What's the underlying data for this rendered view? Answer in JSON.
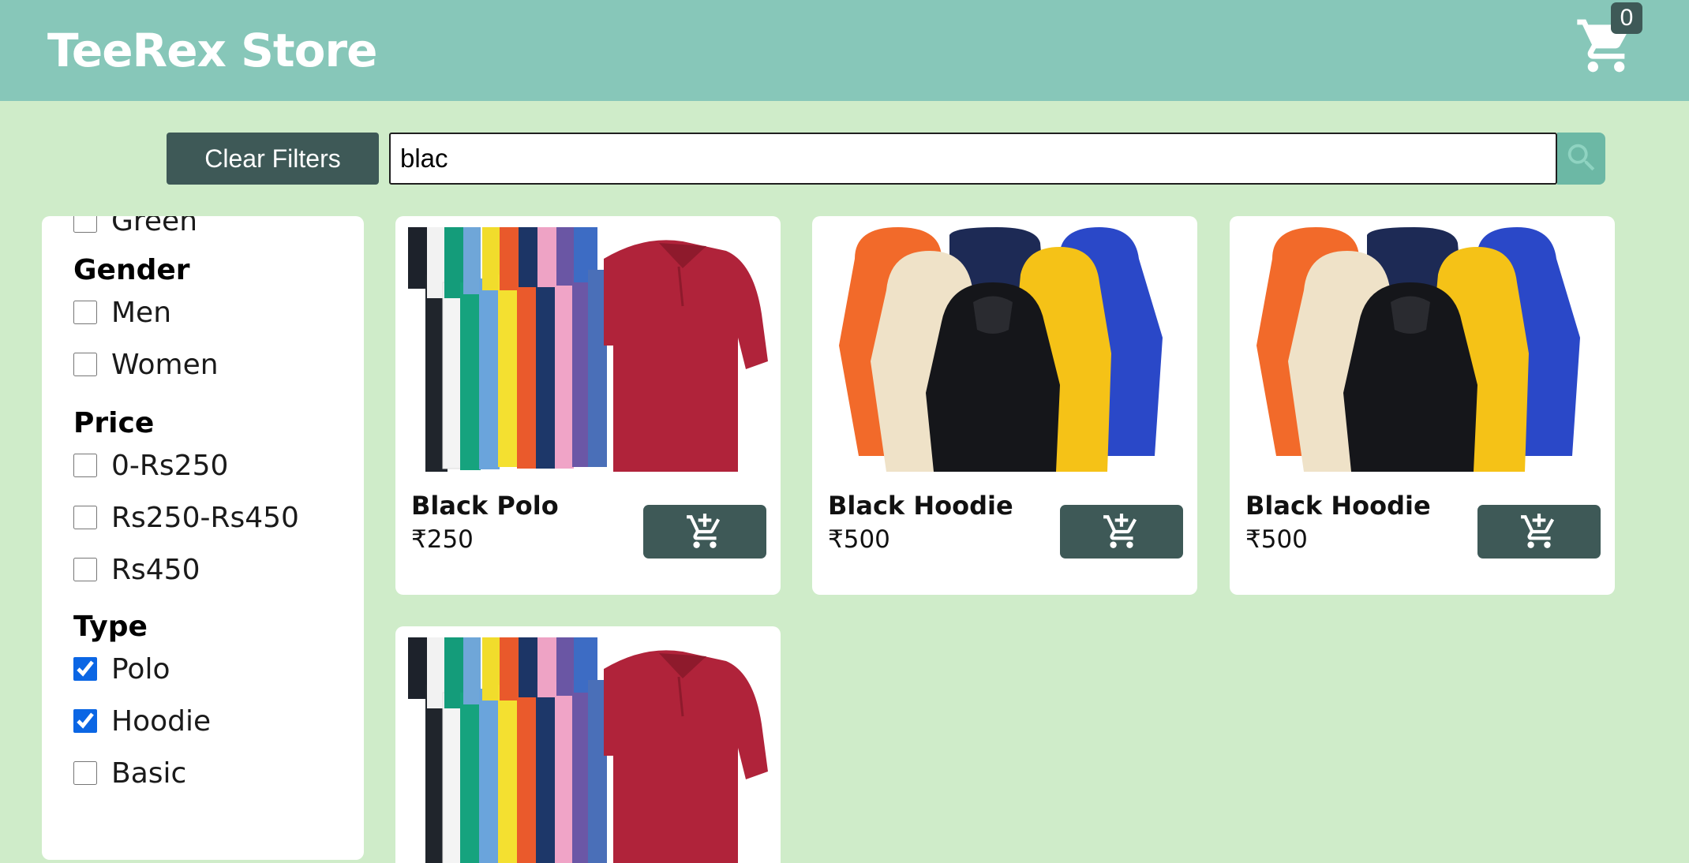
{
  "header": {
    "title": "TeeRex Store",
    "cart_count": "0"
  },
  "toolbar": {
    "clear_label": "Clear Filters",
    "search_value": "blac"
  },
  "filters": {
    "partial_item": "Green",
    "gender": {
      "heading": "Gender",
      "options": [
        {
          "label": "Men",
          "checked": false
        },
        {
          "label": "Women",
          "checked": false
        }
      ]
    },
    "price": {
      "heading": "Price",
      "options": [
        {
          "label": "0-Rs250",
          "checked": false
        },
        {
          "label": "Rs250-Rs450",
          "checked": false
        },
        {
          "label": "Rs450",
          "checked": false
        }
      ]
    },
    "type": {
      "heading": "Type",
      "options": [
        {
          "label": "Polo",
          "checked": true
        },
        {
          "label": "Hoodie",
          "checked": true
        },
        {
          "label": "Basic",
          "checked": false
        }
      ]
    }
  },
  "products": [
    {
      "name": "Black Polo",
      "price": "₹250",
      "image": "polo-shirts"
    },
    {
      "name": "Black Hoodie",
      "price": "₹500",
      "image": "hoodies"
    },
    {
      "name": "Black Hoodie",
      "price": "₹500",
      "image": "hoodies"
    },
    {
      "name": "",
      "price": "",
      "image": "polo-shirts"
    }
  ],
  "colors": {
    "header": "#87c7b9",
    "background": "#cfecc9",
    "button": "#3e5957",
    "search_button": "#6cb8a5"
  },
  "icons": {
    "cart": "cart-icon",
    "search": "search-icon",
    "add_to_cart": "add-to-cart-icon"
  }
}
